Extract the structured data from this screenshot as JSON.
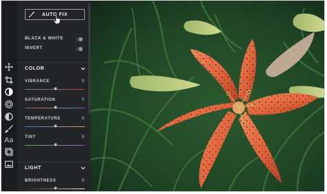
{
  "toolbar": {
    "auto_fix_label": "AUTO FIX"
  },
  "toggles": [
    {
      "label": "BLACK & WHITE",
      "on": false
    },
    {
      "label": "INVERT",
      "on": false
    }
  ],
  "color_section": {
    "title": "COLOR",
    "sliders": [
      {
        "label": "VIBRANCE",
        "value": "0",
        "level": 0.5
      },
      {
        "label": "SATURATION",
        "value": "0",
        "level": 0.5
      },
      {
        "label": "TEMPERATURE",
        "value": "0",
        "level": 0.5
      },
      {
        "label": "TINT",
        "value": "0",
        "level": 0.5
      }
    ]
  },
  "light_section": {
    "title": "LIGHT",
    "sliders": [
      {
        "label": "BRIGHTNESS",
        "value": "0",
        "level": 0.5
      }
    ]
  },
  "rail_icons": [
    "move-icon",
    "crop-icon",
    "adjust-icon",
    "filter-icon",
    "vignette-icon",
    "brush-icon",
    "text-icon",
    "layers-icon",
    "image-icon"
  ],
  "colors": {
    "panel": "#242529",
    "rail": "#1b1c1f",
    "accent_text": "#f1f1f1"
  }
}
